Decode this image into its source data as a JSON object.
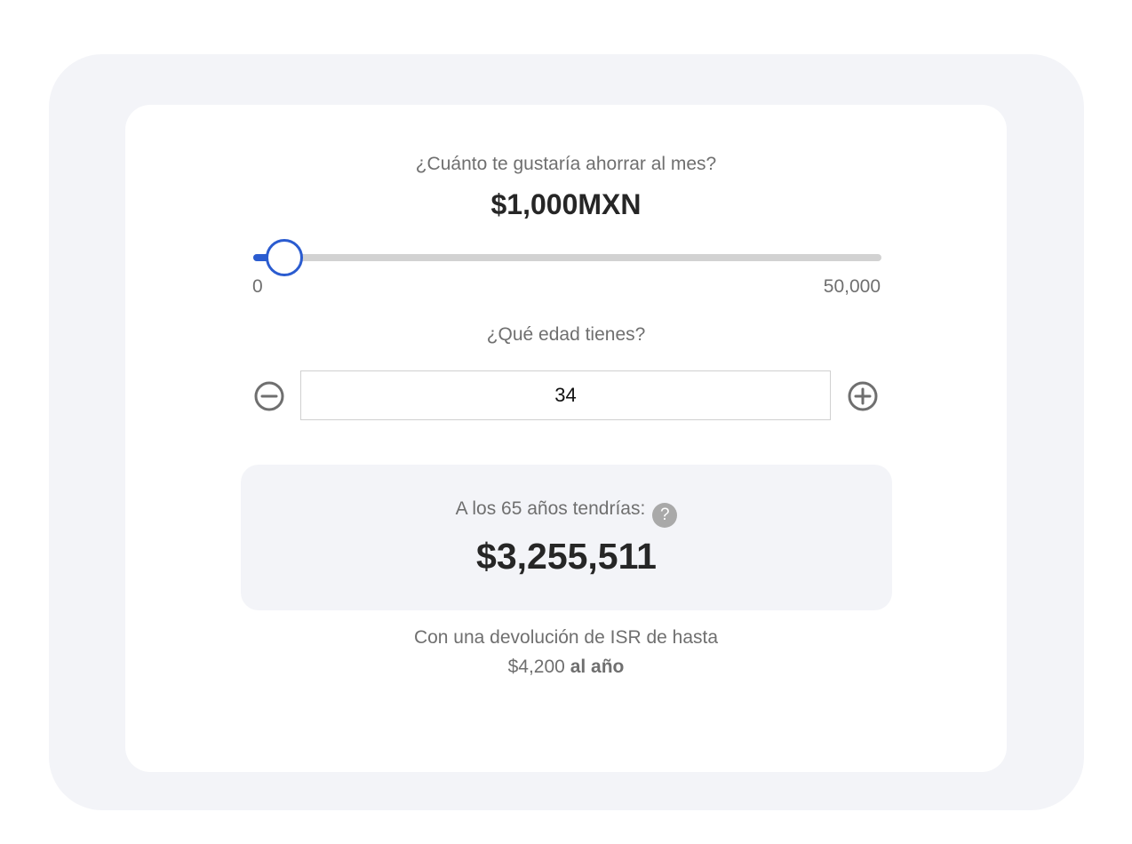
{
  "savings": {
    "question": "¿Cuánto te gustaría ahorrar al mes?",
    "amount_display": "$1,000MXN",
    "slider_value": 1000,
    "slider_min": 0,
    "slider_max": 50000,
    "min_label": "0",
    "max_label": "50,000"
  },
  "age": {
    "question": "¿Qué edad tienes?",
    "value": "34",
    "minus_icon": "minus-circle-icon",
    "plus_icon": "plus-circle-icon"
  },
  "result": {
    "label": "A los 65 años tendrías:",
    "help_symbol": "?",
    "value": "$3,255,511"
  },
  "refund": {
    "line1": "Con una devolución de ISR de hasta",
    "amount": "$4,200",
    "period": "al año"
  },
  "colors": {
    "accent": "#2b5cd0",
    "page_background": "#f3f4f8",
    "card_background": "#ffffff",
    "muted_text": "#6f6f6f",
    "strong_text": "#262626",
    "track": "#d2d2d2",
    "help_badge": "#a9a9a9"
  }
}
